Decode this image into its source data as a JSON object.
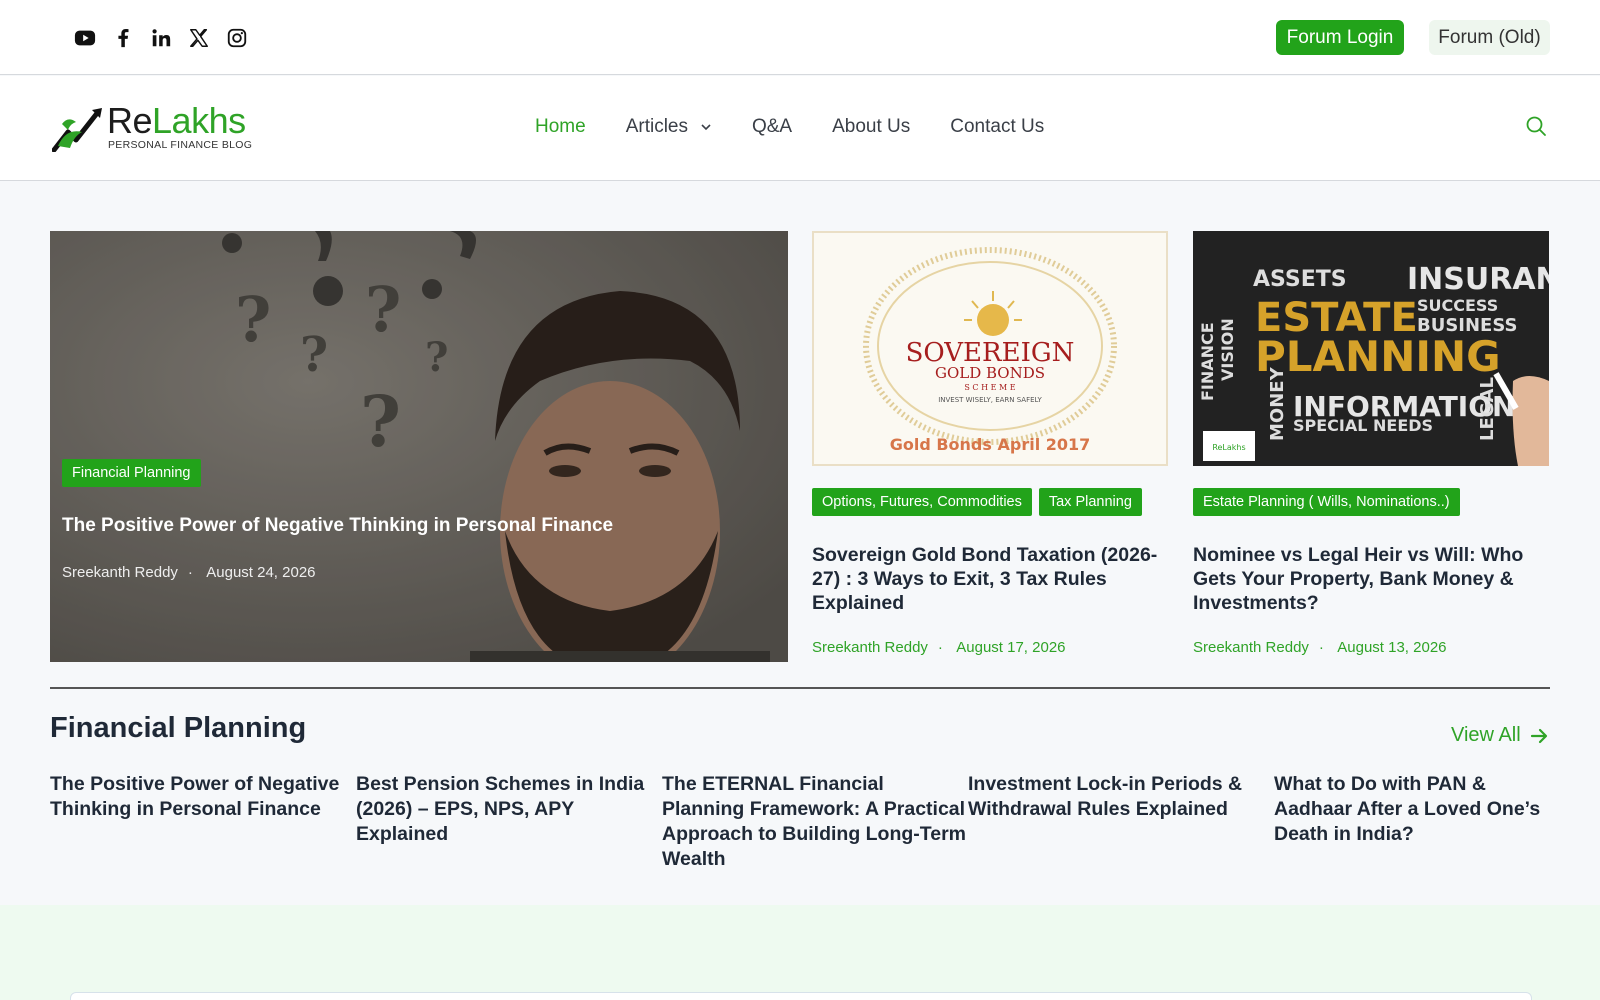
{
  "topbar": {
    "social_icons": [
      "youtube-icon",
      "facebook-icon",
      "linkedin-icon",
      "x-icon",
      "instagram-icon"
    ],
    "forum_login": "Forum Login",
    "forum_old": "Forum (Old)"
  },
  "header": {
    "logo": {
      "re": "Re",
      "lakhs": "Lakhs",
      "tagline": "PERSONAL FINANCE BLOG"
    },
    "nav": [
      {
        "label": "Home",
        "active": true
      },
      {
        "label": "Articles",
        "has_dropdown": true
      },
      {
        "label": "Q&A"
      },
      {
        "label": "About Us"
      },
      {
        "label": "Contact Us"
      }
    ],
    "search_icon": "search-icon"
  },
  "featured": {
    "main": {
      "category": "Financial Planning",
      "title": "The Positive Power of Negative Thinking in Personal Finance",
      "author": "Sreekanth Reddy",
      "date": "August 24, 2026"
    },
    "cards": [
      {
        "categories": [
          "Options, Futures, Commodities",
          "Tax Planning"
        ],
        "image_text": {
          "line1": "SOVEREIGN",
          "line2": "GOLD BONDS",
          "line3": "S C H E M E",
          "line4": "INVEST WISELY, EARN SAFELY",
          "caption": "Gold Bonds April 2017"
        },
        "title": "Sovereign Gold Bond Taxation (2026-27) : 3 Ways to Exit, 3 Tax Rules Explained",
        "author": "Sreekanth Reddy",
        "date": "August 17, 2026"
      },
      {
        "categories": [
          "Estate Planning ( Wills, Nominations..)"
        ],
        "image_text": {
          "estate": "ESTATE",
          "planning": "PLANNING",
          "assets": "ASSETS",
          "insurance": "INSURANCE",
          "information": "INFORMATION",
          "success": "SUCCESS",
          "business": "BUSINESS",
          "special": "SPECIAL NEEDS",
          "money": "MONEY",
          "legal": "LEGAL",
          "finance": "FINANCE",
          "vision": "VISION"
        },
        "title": "Nominee vs Legal Heir vs Will: Who Gets Your Property, Bank Money & Investments?",
        "author": "Sreekanth Reddy",
        "date": "August 13, 2026"
      }
    ]
  },
  "section": {
    "title": "Financial Planning",
    "view_all": "View All",
    "articles": [
      "The Positive Power of Negative Thinking in Personal Finance",
      "Best Pension Schemes in India (2026) – EPS, NPS, APY Explained",
      "The ETERNAL Financial Planning Framework: A Practical Approach to Building Long-Term Wealth",
      "Investment Lock-in Periods & Withdrawal Rules Explained",
      "What to Do with PAN & Aadhaar After a Loved One’s Death in India?"
    ]
  },
  "colors": {
    "brand_green": "#2fa327",
    "pill_green": "#22a31a",
    "text_dark": "#1f2937"
  }
}
